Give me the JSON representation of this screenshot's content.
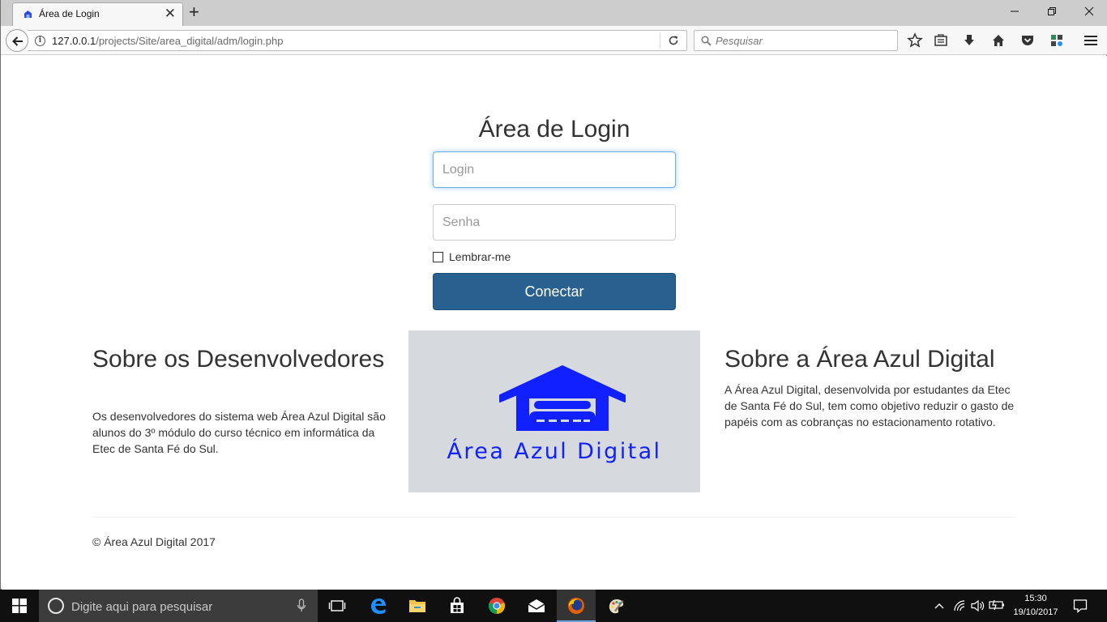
{
  "browser": {
    "tab_title": "Área de Login",
    "url_host": "127.0.0.1",
    "url_path": "/projects/Site/area_digital/adm/login.php",
    "search_placeholder": "Pesquisar",
    "window_controls": [
      "minimize",
      "restore",
      "close"
    ],
    "toolbar_icons": [
      "star-icon",
      "reading-list-icon",
      "download-icon",
      "home-icon",
      "pocket-icon",
      "extension-icon",
      "menu-icon"
    ]
  },
  "page": {
    "login": {
      "title": "Área de Login",
      "login_placeholder": "Login",
      "login_value": "",
      "password_placeholder": "Senha",
      "password_value": "",
      "remember_label": "Lembrar-me",
      "remember_checked": false,
      "submit_label": "Conectar"
    },
    "developers": {
      "heading": "Sobre os Desenvolvedores",
      "text": "Os desenvolvedores do sistema web Área Azul Digital são alunos do 3º módulo do curso técnico em informática da Etec de Santa Fé do Sul."
    },
    "logo": {
      "text": "Área Azul Digital",
      "icon": "garage-car-icon",
      "color": "#1020ff",
      "background": "#d6d9dd"
    },
    "about": {
      "heading": "Sobre a Área Azul Digital",
      "text": "A Área Azul Digital, desenvolvida por estudantes da Etec de Santa Fé do Sul, tem como objetivo reduzir o gasto de papéis com as cobranças no estacionamento rotativo."
    },
    "footer": {
      "text": "© Área Azul Digital 2017"
    },
    "colors": {
      "primary_button": "#286090",
      "focus_border": "#66afe9"
    }
  },
  "taskbar": {
    "search_placeholder": "Digite aqui para pesquisar",
    "apps": [
      "task-view-icon",
      "edge-icon",
      "file-explorer-icon",
      "store-icon",
      "chrome-icon",
      "mail-icon",
      "firefox-icon",
      "paint-icon"
    ],
    "active_app": "firefox-icon",
    "time": "15:30",
    "date": "19/10/2017"
  }
}
